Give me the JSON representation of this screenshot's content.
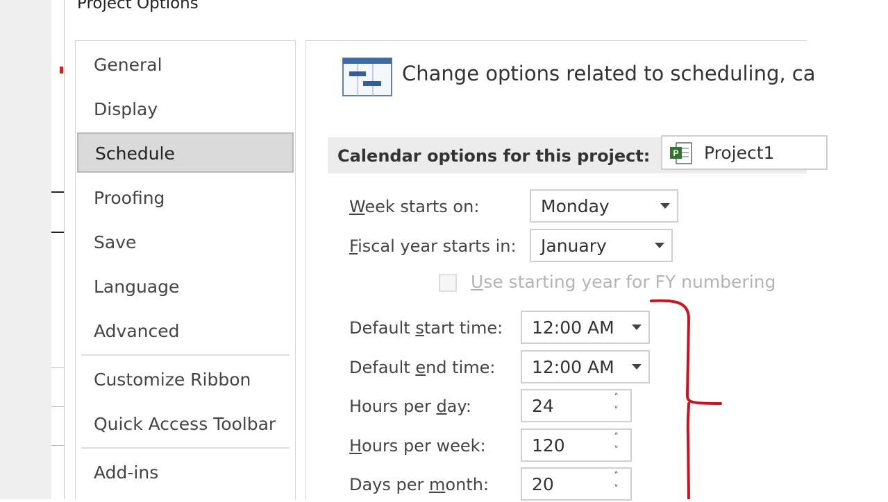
{
  "dialog": {
    "title": "Project Options"
  },
  "nav": {
    "items": [
      {
        "label": "General"
      },
      {
        "label": "Display"
      },
      {
        "label": "Schedule",
        "selected": true
      },
      {
        "label": "Proofing"
      },
      {
        "label": "Save"
      },
      {
        "label": "Language"
      },
      {
        "label": "Advanced"
      },
      {
        "label": "Customize Ribbon"
      },
      {
        "label": "Quick Access Toolbar"
      },
      {
        "label": "Add-ins"
      }
    ]
  },
  "header": {
    "text": "Change options related to scheduling, ca",
    "icon": "schedule-gantt-icon"
  },
  "calendar_section": {
    "label": "Calendar options for this project:",
    "project": "Project1",
    "project_icon": "project-file-icon"
  },
  "fields": {
    "week_starts_label_pre": "",
    "week_starts_label_u": "W",
    "week_starts_label_post": "eek starts on:",
    "week_starts_value": "Monday",
    "fiscal_label_u": "F",
    "fiscal_label_post": "iscal year starts in:",
    "fiscal_value": "January",
    "fy_checkbox_label_u": "U",
    "fy_checkbox_label_post": "se starting year for FY numbering",
    "start_time_label_pre": "Default ",
    "start_time_label_u": "s",
    "start_time_label_post": "tart time:",
    "start_time_value": "12:00 AM",
    "end_time_label_pre": "Default ",
    "end_time_label_u": "e",
    "end_time_label_post": "nd time:",
    "end_time_value": "12:00 AM",
    "hours_day_label_pre": "Hours per ",
    "hours_day_label_u": "d",
    "hours_day_label_post": "ay:",
    "hours_day_value": "24",
    "hours_week_label_u": "H",
    "hours_week_label_post": "ours per week:",
    "hours_week_value": "120",
    "days_month_label_pre": "Days per ",
    "days_month_label_u": "m",
    "days_month_label_post": "onth:",
    "days_month_value": "20"
  },
  "colors": {
    "annotation_red": "#d0101e",
    "selected_bg": "#dadada",
    "section_bg": "#ececec"
  }
}
